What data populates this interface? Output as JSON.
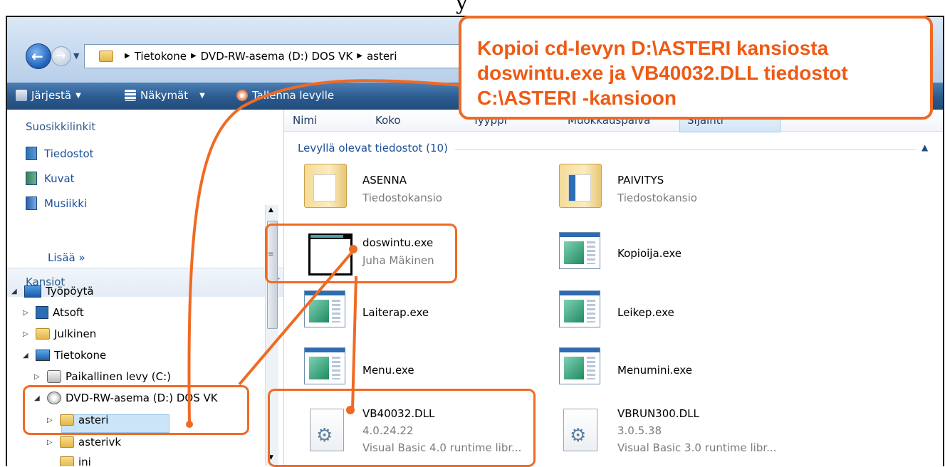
{
  "page_top_glyph": "y",
  "address_bar": {
    "crumbs": [
      "Tietokone",
      "DVD-RW-asema (D:) DOS VK",
      "asteri"
    ]
  },
  "toolbar": {
    "organize": "Järjestä",
    "views": "Näkymät",
    "burn": "Tallenna levylle"
  },
  "nav": {
    "favorites_header": "Suosikkilinkit",
    "favorites": [
      "Tiedostot",
      "Kuvat",
      "Musiikki"
    ],
    "more": "Lisää",
    "more_icon": "double-chevron-right-icon",
    "folders_header": "Kansiot",
    "tree": {
      "desktop": "Työpöytä",
      "atsoft": "Atsoft",
      "public": "Julkinen",
      "computer": "Tietokone",
      "local_disk": "Paikallinen levy (C:)",
      "dvd": "DVD-RW-asema (D:) DOS VK",
      "asteri": "asteri",
      "asterivk": "asterivk",
      "ini": "ini"
    }
  },
  "content": {
    "columns": [
      "Nimi",
      "Koko",
      "Tyyppi",
      "Muokkauspäivä",
      "Sijainti"
    ],
    "group_header": "Levyllä olevat tiedostot (10)",
    "files": {
      "asenna": {
        "name": "ASENNA",
        "sub": "Tiedostokansio"
      },
      "paivitys": {
        "name": "PAIVITYS",
        "sub": "Tiedostokansio"
      },
      "doswintu": {
        "name": "doswintu.exe",
        "sub": "Juha Mäkinen"
      },
      "kopioija": {
        "name": "Kopioija.exe"
      },
      "laiterap": {
        "name": "Laiterap.exe"
      },
      "leikep": {
        "name": "Leikep.exe"
      },
      "menu": {
        "name": "Menu.exe"
      },
      "menumini": {
        "name": "Menumini.exe"
      },
      "vb40032": {
        "name": "VB40032.DLL",
        "version": "4.0.24.22",
        "desc": "Visual Basic 4.0 runtime libr..."
      },
      "vbrun300": {
        "name": "VBRUN300.DLL",
        "version": "3.0.5.38",
        "desc": "Visual Basic 3.0 runtime libr..."
      }
    }
  },
  "annotation": {
    "lines": [
      "Kopioi cd-levyn D:\\ASTERI kansiosta",
      "doswintu.exe ja VB40032.DLL tiedostot",
      "C:\\ASTERI -kansioon"
    ],
    "color": "#f06a23"
  }
}
